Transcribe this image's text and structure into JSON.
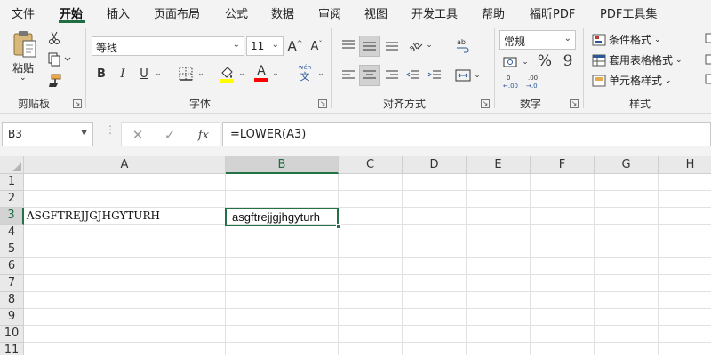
{
  "menu": {
    "tabs": [
      "文件",
      "开始",
      "插入",
      "页面布局",
      "公式",
      "数据",
      "审阅",
      "视图",
      "开发工具",
      "帮助",
      "福昕PDF",
      "PDF工具集"
    ],
    "active": "开始"
  },
  "ribbon": {
    "clipboard": {
      "paste_label": "粘贴",
      "group_label": "剪贴板"
    },
    "font": {
      "font_name": "等线",
      "font_size": "11",
      "bold": "B",
      "italic": "I",
      "underline": "U",
      "grow": "A",
      "shrink": "A",
      "phonetic_top": "wén",
      "phonetic_bottom": "文",
      "font_color_letter": "A",
      "highlight_color": "#ffff00",
      "font_color": "#ff0000",
      "group_label": "字体"
    },
    "alignment": {
      "group_label": "对齐方式"
    },
    "number": {
      "format": "常规",
      "percent": "%",
      "comma": "9",
      "group_label": "数字"
    },
    "styles": {
      "conditional": "条件格式",
      "table": "套用表格格式",
      "cell_styles": "单元格样式",
      "group_label": "样式"
    }
  },
  "formula_bar": {
    "name_box": "B3",
    "fx": "fx",
    "formula": "=LOWER(A3)"
  },
  "sheet": {
    "columns": [
      "A",
      "B",
      "C",
      "D",
      "E",
      "F",
      "G",
      "H"
    ],
    "rows": [
      "1",
      "2",
      "3",
      "4",
      "5",
      "6",
      "7",
      "8",
      "9",
      "10",
      "11"
    ],
    "selected_column": "B",
    "selected_row": "3",
    "cells": {
      "A3": "ASGFTREJJGJHGYTURH",
      "B3": "asgftrejjgjhgyturh"
    },
    "accent": "#217346"
  }
}
